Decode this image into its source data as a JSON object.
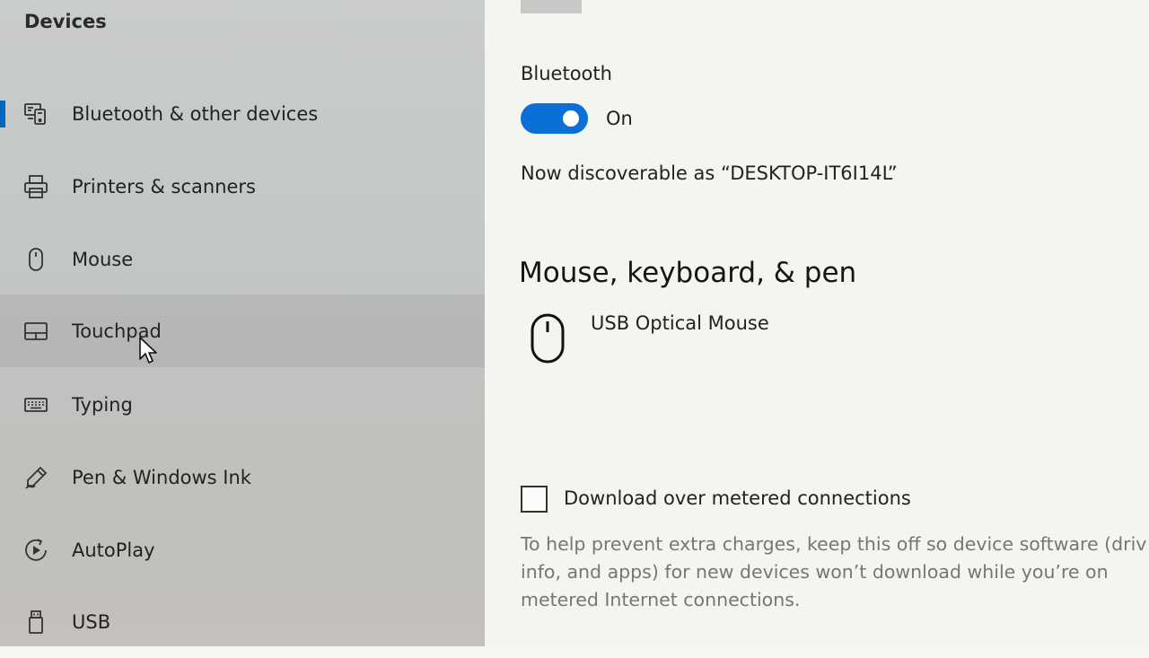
{
  "sidebar": {
    "title": "Devices",
    "items": [
      {
        "label": "Bluetooth & other devices",
        "icon": "bluetooth-devices-icon",
        "selected": true
      },
      {
        "label": "Printers & scanners",
        "icon": "printer-icon"
      },
      {
        "label": "Mouse",
        "icon": "mouse-icon"
      },
      {
        "label": "Touchpad",
        "icon": "touchpad-icon",
        "hovered": true
      },
      {
        "label": "Typing",
        "icon": "keyboard-icon"
      },
      {
        "label": "Pen & Windows Ink",
        "icon": "pen-icon"
      },
      {
        "label": "AutoPlay",
        "icon": "autoplay-icon"
      },
      {
        "label": "USB",
        "icon": "usb-icon"
      }
    ]
  },
  "main": {
    "bluetooth": {
      "label": "Bluetooth",
      "state": "On",
      "discoverable": "Now discoverable as “DESKTOP-IT6I14L”"
    },
    "section_heading": "Mouse, keyboard, & pen",
    "devices": [
      {
        "name": "USB Optical Mouse",
        "icon": "mouse-icon"
      }
    ],
    "metered": {
      "label": "Download over metered connections",
      "checked": false,
      "help_lines": [
        "To help prevent extra charges, keep this off so device software (driv",
        "info, and apps) for new devices won’t download while you’re on",
        "metered Internet connections."
      ]
    }
  },
  "colors": {
    "accent": "#0a6fd6",
    "selection_indicator": "#0067c0",
    "help_text": "#767676"
  }
}
